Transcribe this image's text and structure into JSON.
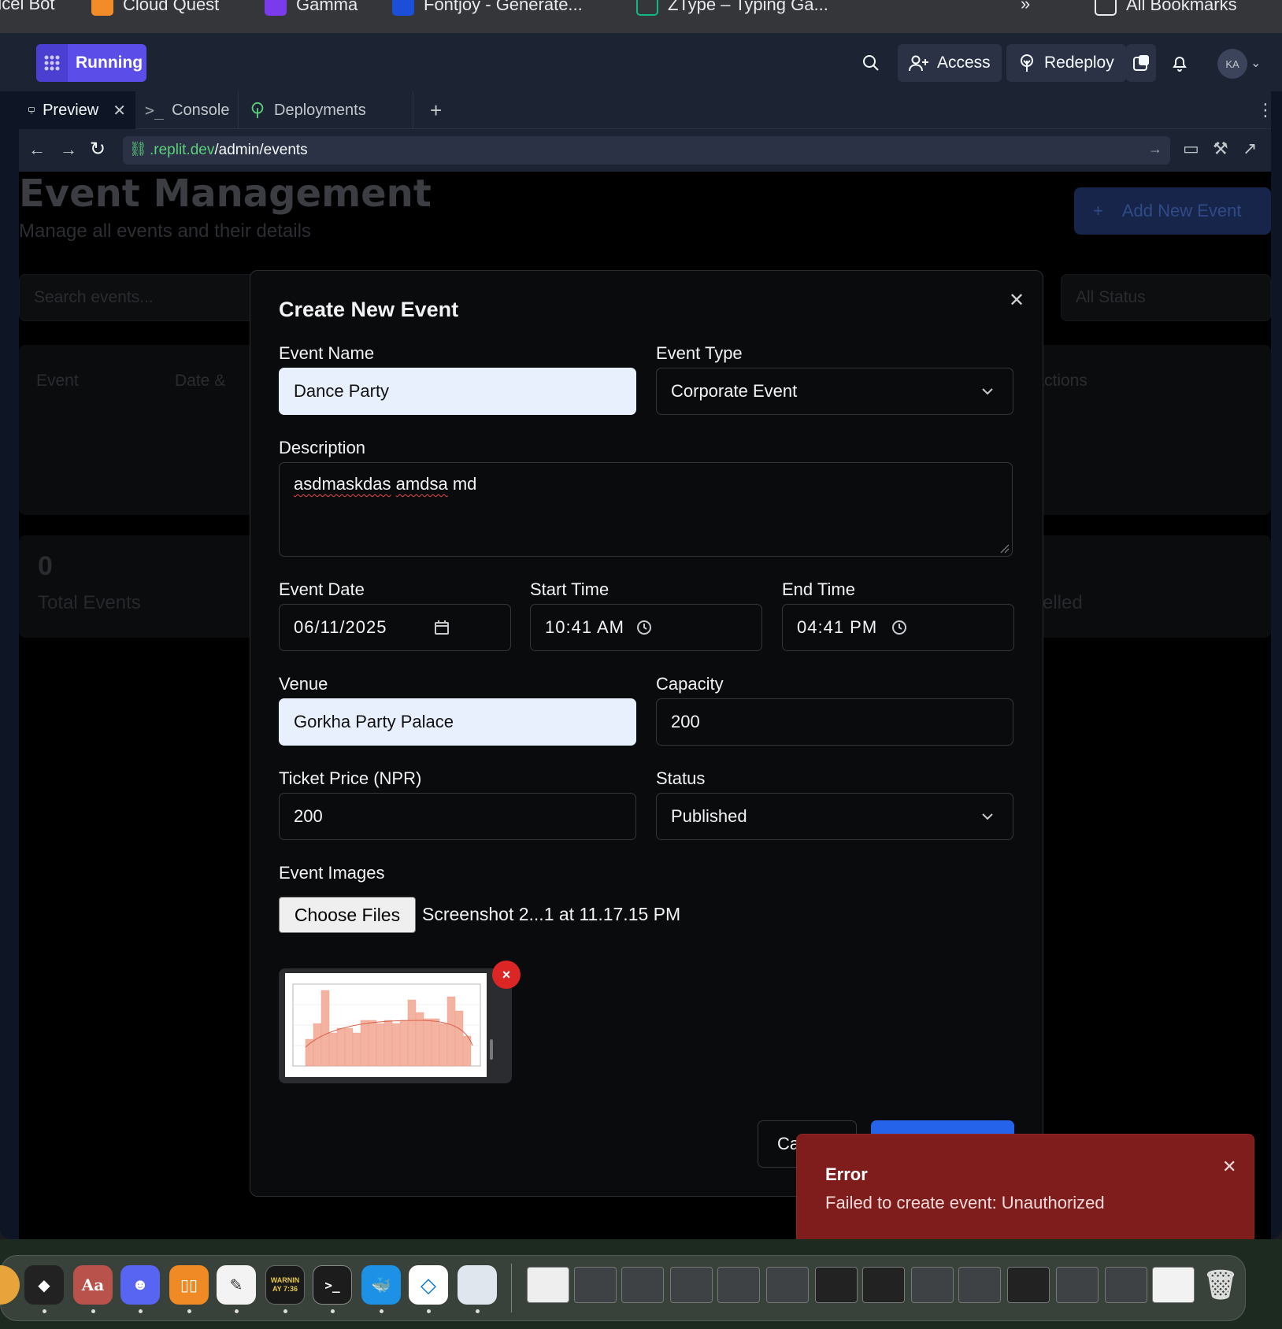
{
  "bookmarks": [
    {
      "label": "ucei Bot",
      "color": "#000000"
    },
    {
      "label": "Cloud Quest",
      "color": "#f28c28"
    },
    {
      "label": "Gamma",
      "color": "#7c3aed"
    },
    {
      "label": "Fontjoy - Generate...",
      "color": "#1d4ed8"
    },
    {
      "label": "ZType – Typing Ga...",
      "color": "#10b981"
    },
    {
      "label": "All Bookmarks",
      "color": "#e8eaed"
    }
  ],
  "topbar": {
    "status": "Running",
    "access": "Access",
    "redeploy": "Redeploy",
    "avatar": "KA"
  },
  "tabs": [
    {
      "label": "Preview",
      "icon": "monitor-icon",
      "active": true
    },
    {
      "label": "Console",
      "icon": "terminal-icon",
      "active": false
    },
    {
      "label": "Deployments",
      "icon": "deploy-icon",
      "active": false
    }
  ],
  "url": {
    "domain": ".replit.dev",
    "path": "/admin/events"
  },
  "background": {
    "title": "Event Management",
    "subtitle": "Manage all events and their details",
    "add_button": "Add New Event",
    "search_placeholder": "Search events...",
    "status_filter": "All Status",
    "columns": [
      "Event",
      "Date &",
      "Actions"
    ],
    "stat_value": "0",
    "stat_label": "Total Events",
    "stat_cancelled": "elled"
  },
  "modal": {
    "title": "Create New Event",
    "labels": {
      "name": "Event Name",
      "type": "Event Type",
      "description": "Description",
      "date": "Event Date",
      "start": "Start Time",
      "end": "End Time",
      "venue": "Venue",
      "capacity": "Capacity",
      "price": "Ticket Price (NPR)",
      "status": "Status",
      "images": "Event Images"
    },
    "values": {
      "name": "Dance Party",
      "type": "Corporate Event",
      "description_words": [
        "asdmaskdas",
        "amdsa",
        "md"
      ],
      "date": "06/11/2025",
      "start": "10:41 AM",
      "end": "04:41 PM",
      "venue": "Gorkha Party Palace",
      "capacity": "200",
      "price": "200",
      "status": "Published"
    },
    "file_button": "Choose Files",
    "file_name": "Screenshot 2...1 at 11.17.15 PM",
    "remove": "×",
    "cancel": "Ca"
  },
  "toast": {
    "title": "Error",
    "description": "Failed to create event: Unauthorized",
    "bg_color": "#7f1d1d"
  },
  "dock": {
    "dictionary_label": "Aa",
    "console_label": "WARNIN\nAY 7:36"
  }
}
